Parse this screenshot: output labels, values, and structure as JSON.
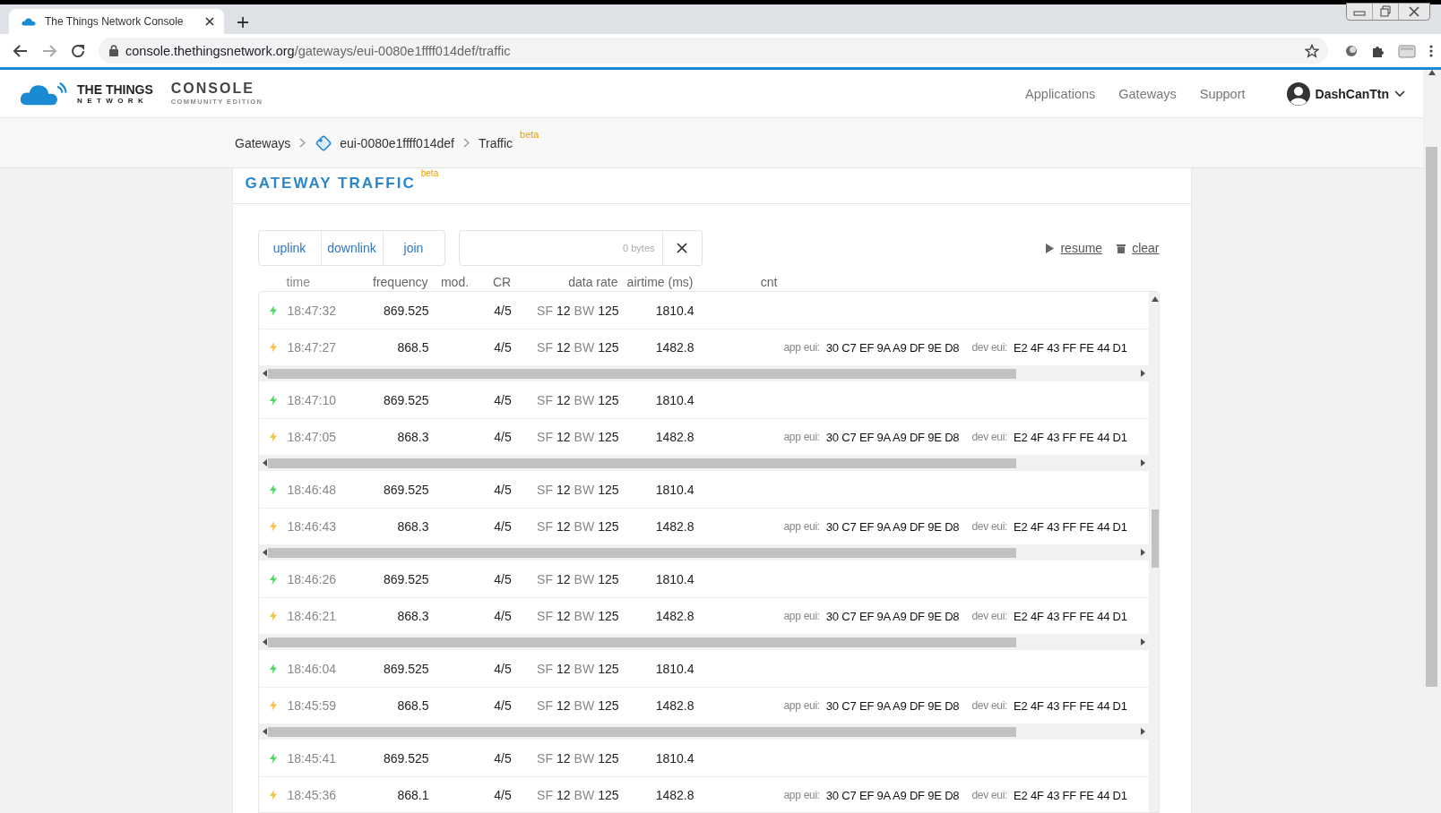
{
  "browser": {
    "tab_title": "The Things Network Console",
    "url_host": "console.thethingsnetwork.org",
    "url_path": "/gateways/eui-0080e1ffff014def/traffic"
  },
  "header": {
    "logo_line1": "THE THINGS",
    "logo_line2": "NETWORK",
    "product": "CONSOLE",
    "edition": "COMMUNITY EDITION",
    "nav": [
      "Applications",
      "Gateways",
      "Support"
    ],
    "user": "DashCanTtn"
  },
  "breadcrumb": [
    {
      "kind": "link",
      "label": "Gateways"
    },
    {
      "kind": "gateway",
      "label": "eui-0080e1ffff014def"
    },
    {
      "kind": "current",
      "label": "Traffic",
      "badge": "beta"
    }
  ],
  "card": {
    "title": "GATEWAY TRAFFIC",
    "badge": "beta",
    "filters": [
      {
        "label": "uplink",
        "selected": false
      },
      {
        "label": "downlink",
        "selected": false
      },
      {
        "label": "join",
        "selected": false
      }
    ],
    "payload_field": {
      "placeholder": "0 bytes"
    },
    "actions": [
      {
        "kind": "resume",
        "label": "resume"
      },
      {
        "kind": "clear",
        "label": "clear"
      }
    ],
    "columns": [
      "time",
      "frequency",
      "mod.",
      "CR",
      "data rate",
      "airtime (ms)",
      "cnt"
    ],
    "groups": [
      {
        "scrollbar": true,
        "rows": [
          {
            "kind": "uplink",
            "time": "18:47:32",
            "frequency": "869.525",
            "cr": "4/5",
            "sf_label": "SF",
            "sf": "12",
            "bw_label": "BW",
            "bw": "125",
            "airtime": "1810.4"
          },
          {
            "kind": "downlink",
            "time": "18:47:27",
            "frequency": "868.5",
            "cr": "4/5",
            "sf_label": "SF",
            "sf": "12",
            "bw_label": "BW",
            "bw": "125",
            "airtime": "1482.8",
            "app_eui_label": "app eui:",
            "app_eui": "30 C7 EF 9A A9 DF 9E D8",
            "dev_eui_label": "dev eui:",
            "dev_eui": "E2 4F 43 FF FE 44 D1"
          }
        ]
      },
      {
        "scrollbar": true,
        "rows": [
          {
            "kind": "uplink",
            "time": "18:47:10",
            "frequency": "869.525",
            "cr": "4/5",
            "sf_label": "SF",
            "sf": "12",
            "bw_label": "BW",
            "bw": "125",
            "airtime": "1810.4"
          },
          {
            "kind": "downlink",
            "time": "18:47:05",
            "frequency": "868.3",
            "cr": "4/5",
            "sf_label": "SF",
            "sf": "12",
            "bw_label": "BW",
            "bw": "125",
            "airtime": "1482.8",
            "app_eui_label": "app eui:",
            "app_eui": "30 C7 EF 9A A9 DF 9E D8",
            "dev_eui_label": "dev eui:",
            "dev_eui": "E2 4F 43 FF FE 44 D1"
          }
        ]
      },
      {
        "scrollbar": true,
        "rows": [
          {
            "kind": "uplink",
            "time": "18:46:48",
            "frequency": "869.525",
            "cr": "4/5",
            "sf_label": "SF",
            "sf": "12",
            "bw_label": "BW",
            "bw": "125",
            "airtime": "1810.4"
          },
          {
            "kind": "downlink",
            "time": "18:46:43",
            "frequency": "868.3",
            "cr": "4/5",
            "sf_label": "SF",
            "sf": "12",
            "bw_label": "BW",
            "bw": "125",
            "airtime": "1482.8",
            "app_eui_label": "app eui:",
            "app_eui": "30 C7 EF 9A A9 DF 9E D8",
            "dev_eui_label": "dev eui:",
            "dev_eui": "E2 4F 43 FF FE 44 D1"
          }
        ]
      },
      {
        "scrollbar": true,
        "rows": [
          {
            "kind": "uplink",
            "time": "18:46:26",
            "frequency": "869.525",
            "cr": "4/5",
            "sf_label": "SF",
            "sf": "12",
            "bw_label": "BW",
            "bw": "125",
            "airtime": "1810.4"
          },
          {
            "kind": "downlink",
            "time": "18:46:21",
            "frequency": "868.3",
            "cr": "4/5",
            "sf_label": "SF",
            "sf": "12",
            "bw_label": "BW",
            "bw": "125",
            "airtime": "1482.8",
            "app_eui_label": "app eui:",
            "app_eui": "30 C7 EF 9A A9 DF 9E D8",
            "dev_eui_label": "dev eui:",
            "dev_eui": "E2 4F 43 FF FE 44 D1"
          }
        ]
      },
      {
        "scrollbar": true,
        "rows": [
          {
            "kind": "uplink",
            "time": "18:46:04",
            "frequency": "869.525",
            "cr": "4/5",
            "sf_label": "SF",
            "sf": "12",
            "bw_label": "BW",
            "bw": "125",
            "airtime": "1810.4"
          },
          {
            "kind": "downlink",
            "time": "18:45:59",
            "frequency": "868.5",
            "cr": "4/5",
            "sf_label": "SF",
            "sf": "12",
            "bw_label": "BW",
            "bw": "125",
            "airtime": "1482.8",
            "app_eui_label": "app eui:",
            "app_eui": "30 C7 EF 9A A9 DF 9E D8",
            "dev_eui_label": "dev eui:",
            "dev_eui": "E2 4F 43 FF FE 44 D1"
          }
        ]
      },
      {
        "rows": [
          {
            "kind": "uplink",
            "time": "18:45:41",
            "frequency": "869.525",
            "cr": "4/5",
            "sf_label": "SF",
            "sf": "12",
            "bw_label": "BW",
            "bw": "125",
            "airtime": "1810.4"
          },
          {
            "kind": "downlink",
            "time": "18:45:36",
            "frequency": "868.1",
            "cr": "4/5",
            "sf_label": "SF",
            "sf": "12",
            "bw_label": "BW",
            "bw": "125",
            "airtime": "1482.8",
            "app_eui_label": "app eui:",
            "app_eui": "30 C7 EF 9A A9 DF 9E D8",
            "dev_eui_label": "dev eui:",
            "dev_eui": "E2 4F 43 FF FE 44 D1"
          }
        ]
      }
    ]
  }
}
